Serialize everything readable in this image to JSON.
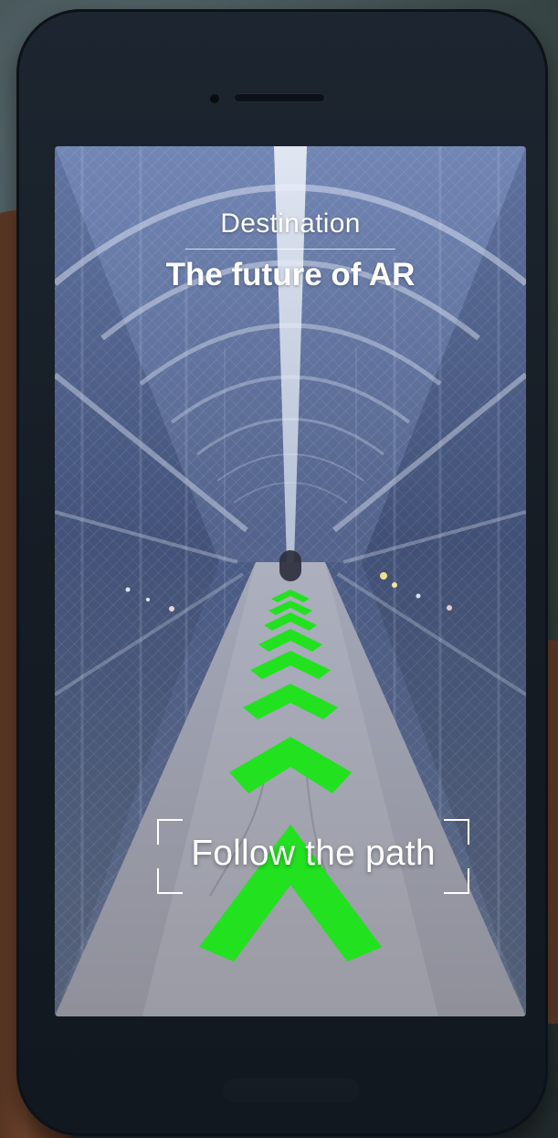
{
  "header": {
    "subtitle": "Destination",
    "title": "The future of AR"
  },
  "overlay": {
    "instruction": "Follow the path"
  },
  "icons": {
    "path_arrow": "chevron-up-icon",
    "focus_frame": "focus-bracket-icon"
  },
  "colors": {
    "path_arrow": "#22e11f",
    "text": "#ffffff",
    "frame": "#ffffff"
  }
}
